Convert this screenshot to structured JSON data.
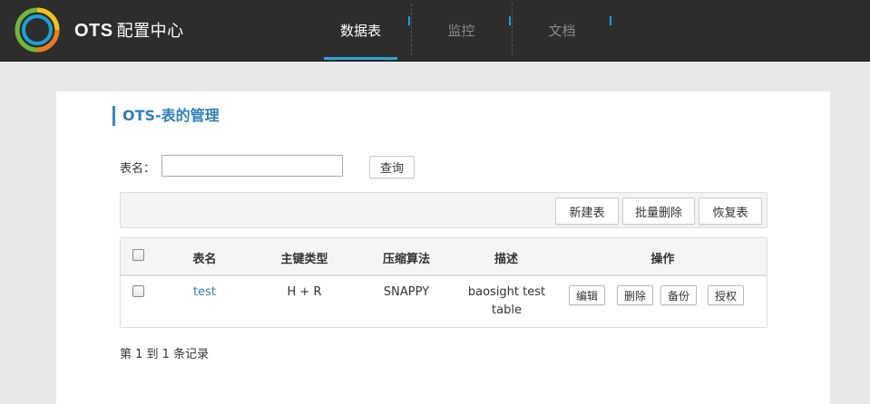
{
  "header": {
    "brand_name": "OTS",
    "brand_sub": "配置中心",
    "tabs": [
      {
        "label": "数据表",
        "active": true
      },
      {
        "label": "监控",
        "active": false
      },
      {
        "label": "文档",
        "active": false
      }
    ]
  },
  "page": {
    "title": "OTS-表的管理"
  },
  "search": {
    "label": "表名：",
    "value": "",
    "placeholder": "",
    "query_label": "查询"
  },
  "toolbar": {
    "new_label": "新建表",
    "batch_delete_label": "批量删除",
    "restore_label": "恢复表"
  },
  "table": {
    "columns": [
      "表名",
      "主键类型",
      "压缩算法",
      "描述",
      "操作"
    ],
    "rows": [
      {
        "name": "test",
        "key_type": "H + R",
        "compression": "SNAPPY",
        "desc_line1": "baosight test",
        "desc_line2": "table",
        "actions": [
          "编辑",
          "删除",
          "备份",
          "授权"
        ]
      }
    ]
  },
  "footer": {
    "record_text": "第 1 到 1 条记录"
  },
  "colors": {
    "header_bg": "#2d2d2d",
    "accent": "#2aa7e0",
    "title": "#2e7fb8",
    "link": "#2f7bb5"
  },
  "icons": {
    "logo": "ring-logo-icon"
  }
}
